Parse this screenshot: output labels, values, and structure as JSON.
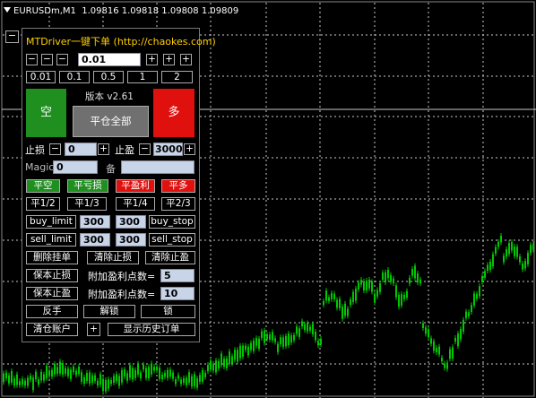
{
  "chart": {
    "symbol": "EURUSDm,M1",
    "prices": "1.09816 1.09818 1.09808 1.09809",
    "colors": {
      "background": "#000000",
      "grid": "#c8c8c8",
      "candles": "#00c800",
      "price_line": "#c8c8c8"
    }
  },
  "panel": {
    "minimize": "−",
    "title": "MTDriver一键下单 (http://chaokes.com)",
    "lot_row": {
      "minus": "−",
      "plus": "+",
      "value": "0.01"
    },
    "lot_presets": [
      "0.01",
      "0.1",
      "0.5",
      "1",
      "2"
    ],
    "sell_btn": "空",
    "buy_btn": "多",
    "version": "版本 v2.61",
    "close_all": "平仓全部",
    "stop_loss_label": "止损",
    "stop_loss_value": "0",
    "take_profit_label": "止盈",
    "take_profit_value": "3000",
    "magic_label": "Magic",
    "magic_value": "0",
    "note_label": "备",
    "note_value": "",
    "close_row": [
      "平空",
      "平亏损",
      "平盈利",
      "平多"
    ],
    "partial_row": [
      "平1/2",
      "平1/3",
      "平1/4",
      "平2/3"
    ],
    "buy_limit": "buy_limit",
    "buy_limit_v1": "300",
    "buy_limit_v2": "300",
    "buy_stop": "buy_stop",
    "sell_limit": "sell_limit",
    "sell_limit_v1": "300",
    "sell_limit_v2": "300",
    "sell_stop": "sell_stop",
    "delete_pending": "删除挂单",
    "clear_sl": "清除止损",
    "clear_tp": "清除止盈",
    "breakeven_sl": "保本止损",
    "extra_tp_pts_label": "附加盈利点数=",
    "extra_tp_pts_value": "5",
    "breakeven_tp": "保本止盈",
    "extra_tp_pts_label2": "附加盈利点数=",
    "extra_tp_pts_value2": "10",
    "reverse": "反手",
    "unlock": "解锁",
    "lock": "锁",
    "clear_account": "清仓账户",
    "plus": "+",
    "show_history": "显示历史订单"
  }
}
